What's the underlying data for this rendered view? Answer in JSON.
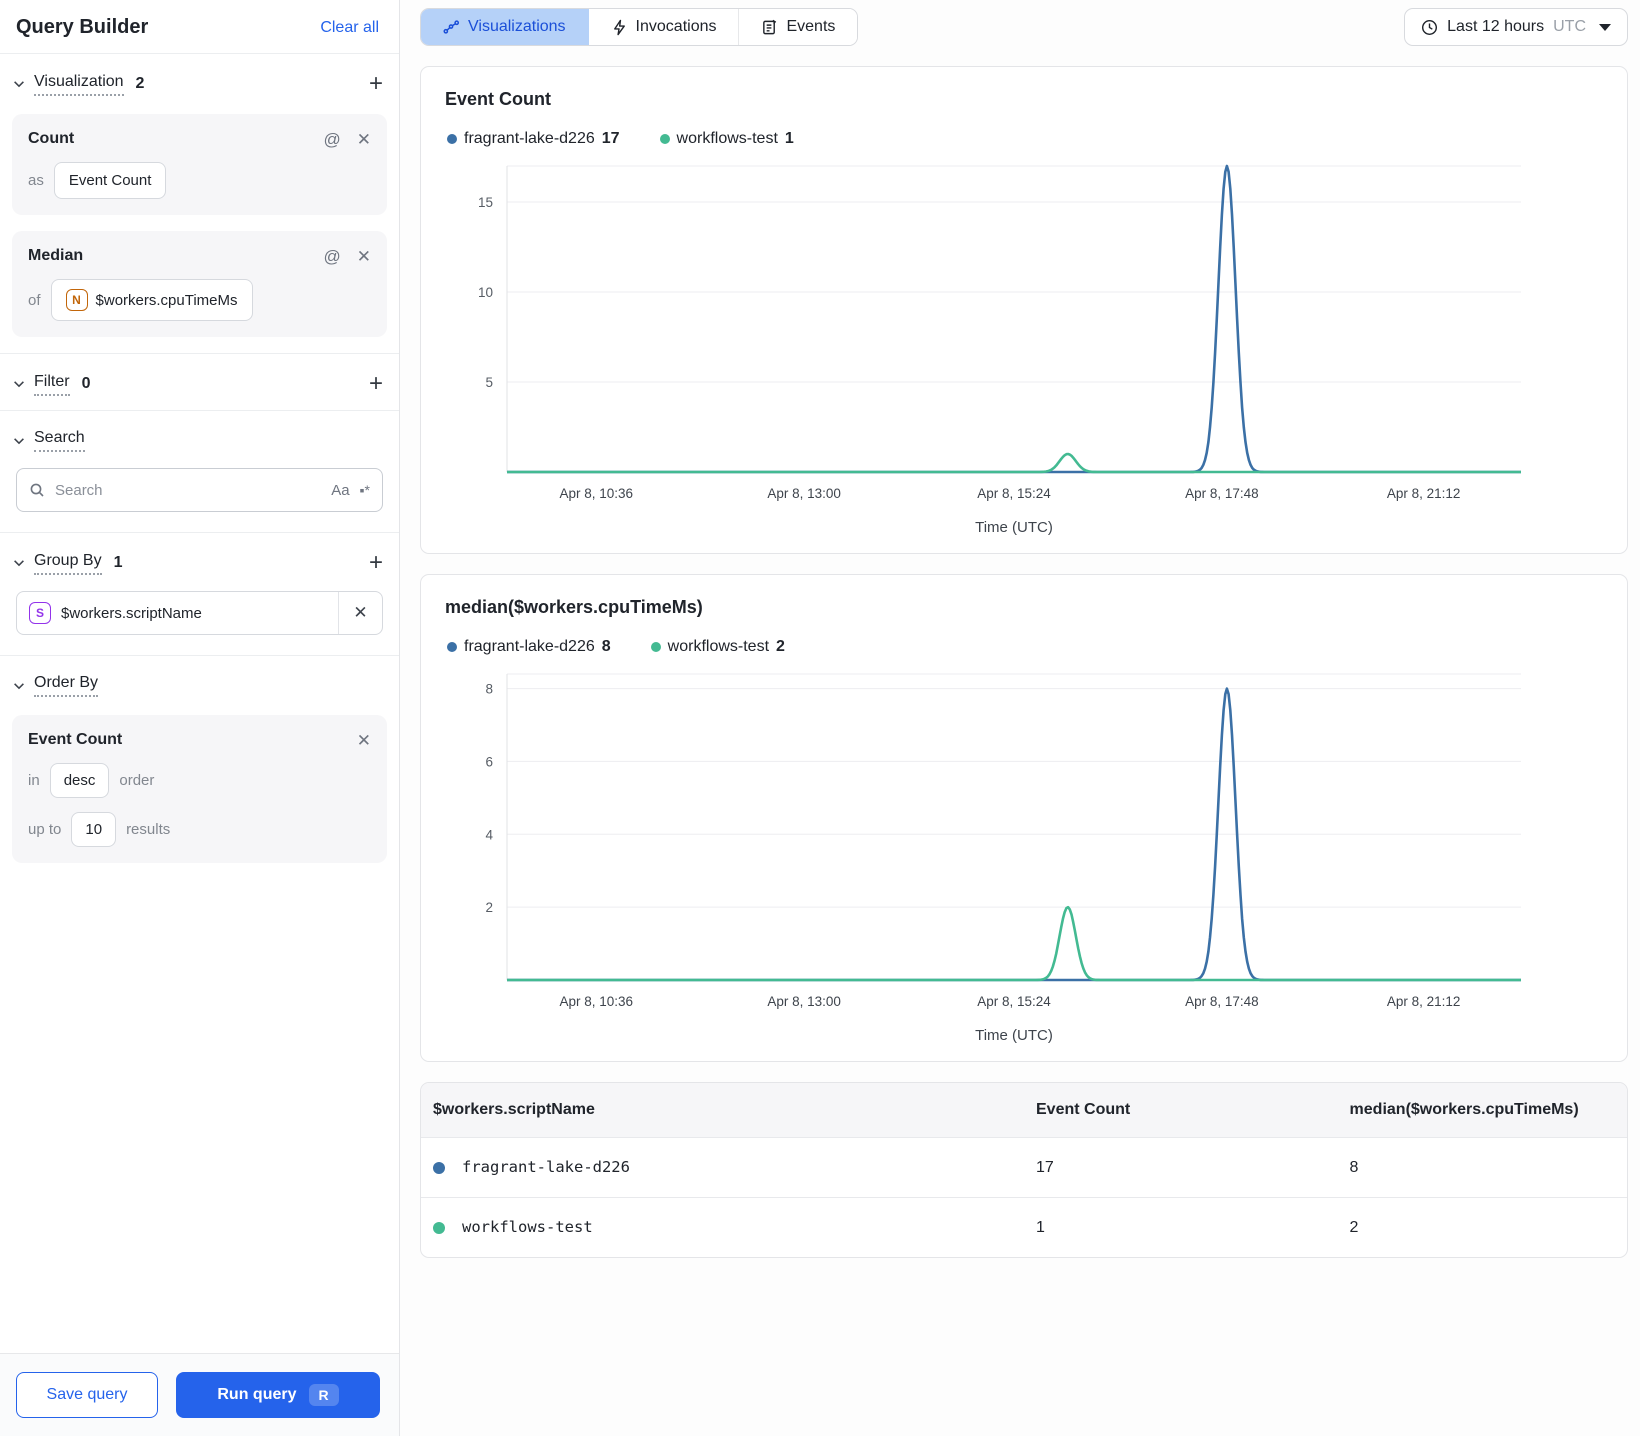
{
  "sidebar": {
    "title": "Query Builder",
    "clear_all_label": "Clear all",
    "visualization": {
      "label": "Visualization",
      "count": "2",
      "cards": [
        {
          "title": "Count",
          "prefix": "as",
          "value": "Event Count"
        },
        {
          "title": "Median",
          "prefix": "of",
          "value": "$workers.cpuTimeMs",
          "value_icon": "N"
        }
      ]
    },
    "filter": {
      "label": "Filter",
      "count": "0"
    },
    "search": {
      "label": "Search",
      "placeholder": "Search",
      "case_toggle": "Aa",
      "regex_toggle": "▪*"
    },
    "group_by": {
      "label": "Group By",
      "count": "1",
      "items": [
        {
          "icon": "S",
          "value": "$workers.scriptName"
        }
      ]
    },
    "order_by": {
      "label": "Order By",
      "field": "Event Count",
      "in_label": "in",
      "direction": "desc",
      "order_label": "order",
      "up_to_label": "up to",
      "limit": "10",
      "results_label": "results"
    },
    "footer": {
      "save_label": "Save query",
      "run_label": "Run query",
      "run_shortcut": "R"
    }
  },
  "topbar": {
    "tabs": [
      {
        "label": "Visualizations",
        "active": true
      },
      {
        "label": "Invocations",
        "active": false
      },
      {
        "label": "Events",
        "active": false
      }
    ],
    "time_range": {
      "label": "Last 12 hours",
      "timezone": "UTC"
    }
  },
  "colors": {
    "series_blue": "#3b70a6",
    "series_green": "#43ba92",
    "accent_blue": "#2563eb",
    "active_tab_bg": "#b5d1f8",
    "active_tab_text": "#1b4fd8"
  },
  "chart_data": [
    {
      "type": "line",
      "title": "Event Count",
      "xlabel": "Time (UTC)",
      "x_tick_labels": [
        "Apr 8, 10:36",
        "Apr 8, 13:00",
        "Apr 8, 15:24",
        "Apr 8, 17:48",
        "Apr 8, 21:12"
      ],
      "x_tick_fracs": [
        0.088,
        0.293,
        0.5,
        0.705,
        0.904
      ],
      "y_ticks": [
        5,
        10,
        15
      ],
      "ylim": [
        0,
        17
      ],
      "grid": true,
      "legend_position": "top",
      "series": [
        {
          "name": "fragrant-lake-d226",
          "color": "#3b70a6",
          "legend_value": "17",
          "baseline": 0,
          "peaks": [
            {
              "center": 0.71,
              "height": 17,
              "sigma": 0.0085
            }
          ]
        },
        {
          "name": "workflows-test",
          "color": "#43ba92",
          "legend_value": "1",
          "baseline": 0,
          "peaks": [
            {
              "center": 0.553,
              "height": 1,
              "sigma": 0.008
            }
          ]
        }
      ]
    },
    {
      "type": "line",
      "title": "median($workers.cpuTimeMs)",
      "xlabel": "Time (UTC)",
      "x_tick_labels": [
        "Apr 8, 10:36",
        "Apr 8, 13:00",
        "Apr 8, 15:24",
        "Apr 8, 17:48",
        "Apr 8, 21:12"
      ],
      "x_tick_fracs": [
        0.088,
        0.293,
        0.5,
        0.705,
        0.904
      ],
      "y_ticks": [
        2,
        4,
        6,
        8
      ],
      "ylim": [
        0,
        8.4
      ],
      "grid": true,
      "legend_position": "top",
      "series": [
        {
          "name": "fragrant-lake-d226",
          "color": "#3b70a6",
          "legend_value": "8",
          "baseline": 0,
          "peaks": [
            {
              "center": 0.71,
              "height": 8,
              "sigma": 0.0085
            }
          ]
        },
        {
          "name": "workflows-test",
          "color": "#43ba92",
          "legend_value": "2",
          "baseline": 0,
          "peaks": [
            {
              "center": 0.553,
              "height": 2,
              "sigma": 0.008
            }
          ]
        }
      ]
    }
  ],
  "table": {
    "columns": [
      "$workers.scriptName",
      "Event Count",
      "median($workers.cpuTimeMs)"
    ],
    "rows": [
      {
        "dot_color": "#3b70a6",
        "script_name": "fragrant-lake-d226",
        "event_count": "17",
        "median": "8"
      },
      {
        "dot_color": "#43ba92",
        "script_name": "workflows-test",
        "event_count": "1",
        "median": "2"
      }
    ]
  }
}
